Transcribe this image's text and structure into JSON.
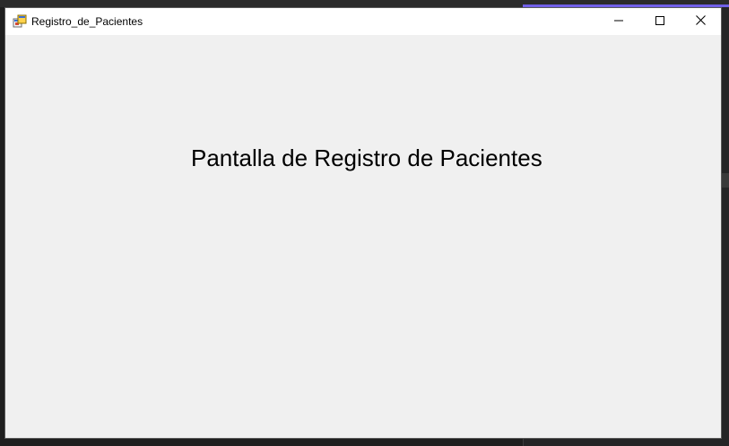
{
  "window": {
    "title": "Registro_de_Pacientes",
    "app_icon": "winforms-app-icon",
    "controls": {
      "minimize_icon": "minimize-icon",
      "maximize_icon": "maximize-icon",
      "close_icon": "close-icon"
    }
  },
  "form": {
    "heading": "Pantalla de Registro de Pacientes"
  },
  "colors": {
    "client_background": "#f0f0f0",
    "titlebar_background": "#ffffff",
    "ide_background": "#1f1f1f",
    "accent": "#7160e8"
  }
}
